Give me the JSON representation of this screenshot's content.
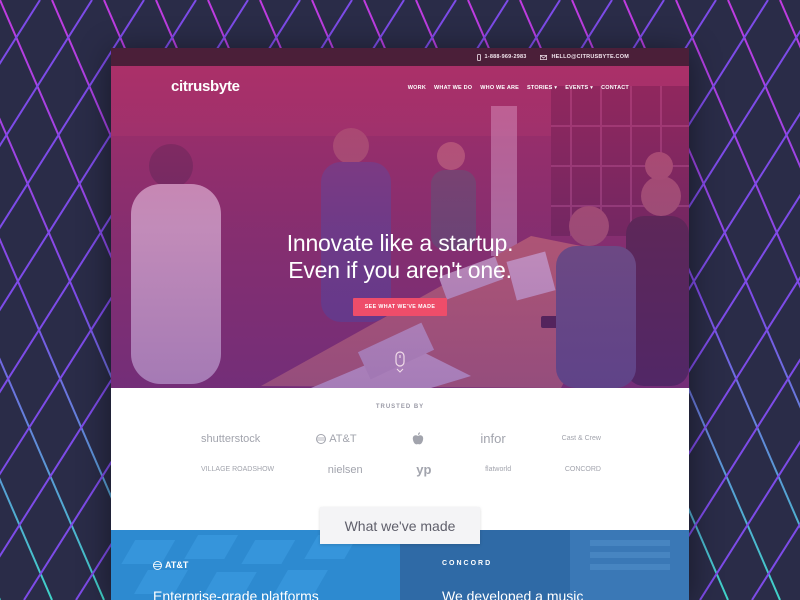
{
  "topbar": {
    "phone": "1-888-969-2983",
    "email": "HELLO@CITRUSBYTE.COM"
  },
  "brand": {
    "logo_text": "citrusbyte"
  },
  "nav": {
    "items": [
      "WORK",
      "WHAT WE DO",
      "WHO WE ARE",
      "STORIES",
      "EVENTS",
      "CONTACT"
    ]
  },
  "hero": {
    "title_line1": "Innovate like a startup.",
    "title_line2": "Even if you aren't one.",
    "cta_label": "SEE WHAT WE'VE MADE"
  },
  "trusted": {
    "label": "TRUSTED BY",
    "row1": [
      "shutterstock",
      "AT&T",
      "",
      "infor",
      "Cast & Crew"
    ],
    "row2": [
      "VILLAGE ROADSHOW",
      "nielsen",
      "yp",
      "flatworld",
      "CONCORD"
    ]
  },
  "made": {
    "label": "What we've made"
  },
  "tiles": {
    "left": {
      "logo": "AT&T",
      "title": "Enterprise-grade platforms"
    },
    "right": {
      "logo": "CONCORD",
      "title": "We developed a music"
    }
  },
  "colors": {
    "background": "#2b2d49",
    "topbar": "#4b1f39",
    "cta": "#ee4d6a",
    "tile_left": "#2d8ad0",
    "tile_right": "#2f6aa6"
  }
}
